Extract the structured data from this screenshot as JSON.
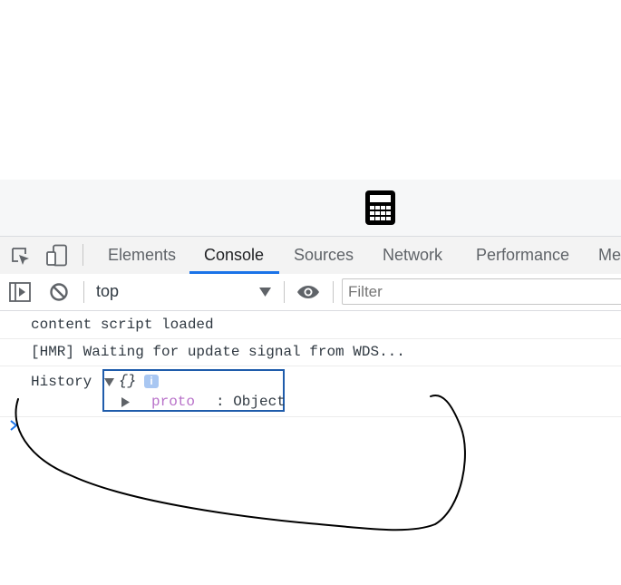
{
  "app_icon": {
    "name": "calculator-icon",
    "color": "#000000"
  },
  "devtools": {
    "toolbar_icons": [
      "inspect-element-icon",
      "device-toggle-icon"
    ],
    "tabs": [
      {
        "label": "Elements",
        "active": false
      },
      {
        "label": "Console",
        "active": true
      },
      {
        "label": "Sources",
        "active": false
      },
      {
        "label": "Network",
        "active": false
      },
      {
        "label": "Performance",
        "active": false
      },
      {
        "label": "Me",
        "active": false
      }
    ],
    "accent_color": "#1a73e8"
  },
  "console_toolbar": {
    "context": "top",
    "filter_placeholder": "Filter",
    "icons": [
      "show-sidebar-icon",
      "clear-console-icon",
      "context-dropdown-arrow",
      "live-expression-eye-icon"
    ]
  },
  "messages": [
    {
      "text": "content script loaded"
    },
    {
      "text": "[HMR] Waiting for update signal from WDS..."
    },
    {
      "label": "History",
      "object_preview": "{}",
      "info_badge": "i",
      "property_key": "proto",
      "property_value": ": Object"
    }
  ],
  "annotation": {
    "box_color": "#1f5cab",
    "scribble_color": "#000000"
  }
}
